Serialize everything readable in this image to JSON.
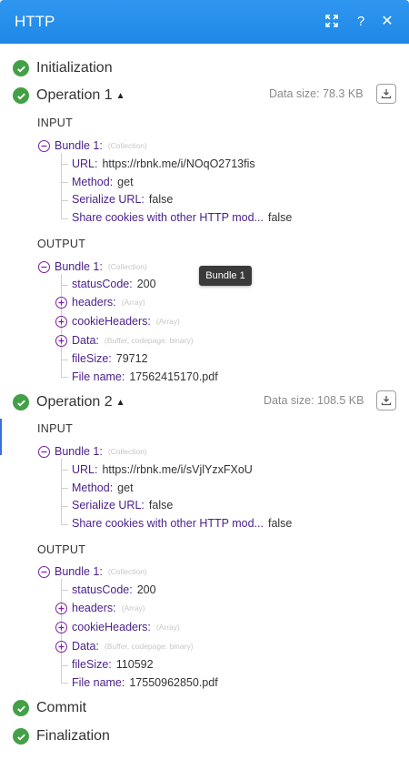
{
  "window": {
    "title": "HTTP"
  },
  "steps": {
    "initialization": "Initialization",
    "commit": "Commit",
    "finalization": "Finalization"
  },
  "tooltip": "Bundle 1",
  "op1": {
    "label": "Operation 1",
    "datasize": "Data size: 78.3 KB",
    "input_label": "INPUT",
    "output_label": "OUTPUT",
    "input": {
      "bundle": "Bundle 1:",
      "type": "(Collection)",
      "url_k": "URL:",
      "url_v": "https://rbnk.me/i/NOqO2713fis",
      "method_k": "Method:",
      "method_v": "get",
      "ser_k": "Serialize URL:",
      "ser_v": "false",
      "share_k": "Share cookies with other HTTP mod...",
      "share_v": "false"
    },
    "output": {
      "bundle": "Bundle 1:",
      "type": "(Collection)",
      "status_k": "statusCode:",
      "status_v": "200",
      "headers_k": "headers:",
      "headers_t": "(Array)",
      "cookie_k": "cookieHeaders:",
      "cookie_t": "(Array)",
      "data_k": "Data:",
      "data_t": "(Buffer, codepage: binary)",
      "fs_k": "fileSize:",
      "fs_v": "79712",
      "fn_k": "File name:",
      "fn_v": "17562415170.pdf"
    }
  },
  "op2": {
    "label": "Operation 2",
    "datasize": "Data size: 108.5 KB",
    "input_label": "INPUT",
    "output_label": "OUTPUT",
    "input": {
      "bundle": "Bundle 1:",
      "type": "(Collection)",
      "url_k": "URL:",
      "url_v": "https://rbnk.me/i/sVjlYzxFXoU",
      "method_k": "Method:",
      "method_v": "get",
      "ser_k": "Serialize URL:",
      "ser_v": "false",
      "share_k": "Share cookies with other HTTP mod...",
      "share_v": "false"
    },
    "output": {
      "bundle": "Bundle 1:",
      "type": "(Collection)",
      "status_k": "statusCode:",
      "status_v": "200",
      "headers_k": "headers:",
      "headers_t": "(Array)",
      "cookie_k": "cookieHeaders:",
      "cookie_t": "(Array)",
      "data_k": "Data:",
      "data_t": "(Buffer, codepage: binary)",
      "fs_k": "fileSize:",
      "fs_v": "110592",
      "fn_k": "File name:",
      "fn_v": "17550962850.pdf"
    }
  }
}
